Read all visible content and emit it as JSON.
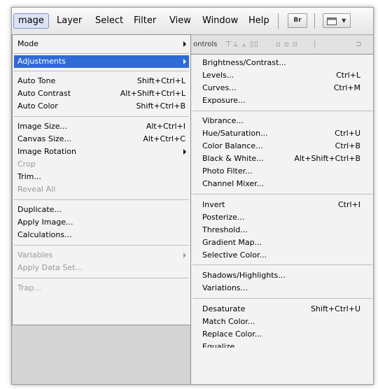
{
  "menubar": {
    "items": [
      "mage",
      "Layer",
      "Select",
      "Filter",
      "View",
      "Window",
      "Help"
    ],
    "br_label": "Br"
  },
  "options_bar": {
    "label": "ontrols"
  },
  "image_menu": {
    "mode": "Mode",
    "adjustments": "Adjustments",
    "auto_tone": {
      "label": "Auto Tone",
      "shortcut": "Shift+Ctrl+L"
    },
    "auto_contrast": {
      "label": "Auto Contrast",
      "shortcut": "Alt+Shift+Ctrl+L"
    },
    "auto_color": {
      "label": "Auto Color",
      "shortcut": "Shift+Ctrl+B"
    },
    "image_size": {
      "label": "Image Size...",
      "shortcut": "Alt+Ctrl+I"
    },
    "canvas_size": {
      "label": "Canvas Size...",
      "shortcut": "Alt+Ctrl+C"
    },
    "image_rotation": "Image Rotation",
    "crop": "Crop",
    "trim": "Trim...",
    "reveal_all": "Reveal All",
    "duplicate": "Duplicate...",
    "apply_image": "Apply Image...",
    "calculations": "Calculations...",
    "variables": "Variables",
    "apply_data_set": "Apply Data Set...",
    "trap": "Trap..."
  },
  "adjustments_menu": {
    "brightness_contrast": {
      "label": "Brightness/Contrast...",
      "shortcut": ""
    },
    "levels": {
      "label": "Levels...",
      "shortcut": "Ctrl+L"
    },
    "curves": {
      "label": "Curves...",
      "shortcut": "Ctrl+M"
    },
    "exposure": {
      "label": "Exposure...",
      "shortcut": ""
    },
    "vibrance": {
      "label": "Vibrance...",
      "shortcut": ""
    },
    "hue_saturation": {
      "label": "Hue/Saturation...",
      "shortcut": "Ctrl+U"
    },
    "color_balance": {
      "label": "Color Balance...",
      "shortcut": "Ctrl+B"
    },
    "black_white": {
      "label": "Black & White...",
      "shortcut": "Alt+Shift+Ctrl+B"
    },
    "photo_filter": {
      "label": "Photo Filter...",
      "shortcut": ""
    },
    "channel_mixer": {
      "label": "Channel Mixer...",
      "shortcut": ""
    },
    "invert": {
      "label": "Invert",
      "shortcut": "Ctrl+I"
    },
    "posterize": {
      "label": "Posterize...",
      "shortcut": ""
    },
    "threshold": {
      "label": "Threshold...",
      "shortcut": ""
    },
    "gradient_map": {
      "label": "Gradient Map...",
      "shortcut": ""
    },
    "selective_color": {
      "label": "Selective Color...",
      "shortcut": ""
    },
    "shadows_highlights": {
      "label": "Shadows/Highlights...",
      "shortcut": ""
    },
    "variations": {
      "label": "Variations...",
      "shortcut": ""
    },
    "desaturate": {
      "label": "Desaturate",
      "shortcut": "Shift+Ctrl+U"
    },
    "match_color": {
      "label": "Match Color...",
      "shortcut": ""
    },
    "replace_color": {
      "label": "Replace Color...",
      "shortcut": ""
    },
    "equalize": {
      "label": "Equalize",
      "shortcut": ""
    }
  },
  "colors": {
    "highlight": "#2f6bd6",
    "menu_bg": "#f3f3f3",
    "disabled": "#9a9a9a"
  }
}
